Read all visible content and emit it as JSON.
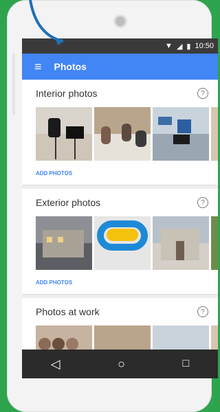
{
  "status": {
    "time": "10:50"
  },
  "appbar": {
    "title": "Photos"
  },
  "sections": [
    {
      "title": "Interior photos",
      "action": "ADD PHOTOS"
    },
    {
      "title": "Exterior photos",
      "action": "ADD PHOTOS"
    },
    {
      "title": "Photos at work"
    }
  ],
  "colors": {
    "background": "#2ea44f",
    "appbar": "#4285f4",
    "accent": "#4285f4"
  }
}
